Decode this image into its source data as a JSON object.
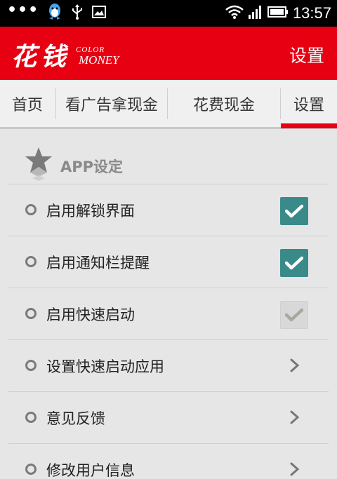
{
  "status_bar": {
    "dots": "•••",
    "time": "13:57"
  },
  "header": {
    "logo_cn": "花钱",
    "logo_en_top": "COLOR",
    "logo_en_bottom": "MONEY",
    "title": "设置"
  },
  "tabs": [
    {
      "label": "首页",
      "active": false
    },
    {
      "label": "看广告拿现金",
      "active": false
    },
    {
      "label": "花费现金",
      "active": false
    },
    {
      "label": "设置",
      "active": true
    }
  ],
  "section": {
    "title": "APP设定",
    "icon": "star-icon"
  },
  "settings": [
    {
      "label": "启用解锁界面",
      "control": "checkbox",
      "checked": true,
      "enabled": true
    },
    {
      "label": "启用通知栏提醒",
      "control": "checkbox",
      "checked": true,
      "enabled": true
    },
    {
      "label": "启用快速启动",
      "control": "checkbox",
      "checked": true,
      "enabled": false
    },
    {
      "label": "设置快速启动应用",
      "control": "chevron-right-icon"
    },
    {
      "label": "意见反馈",
      "control": "chevron-right-icon"
    },
    {
      "label": "修改用户信息",
      "control": "chevron-right-icon"
    }
  ],
  "colors": {
    "brand_red": "#e60012",
    "checkbox_on": "#3a8a8a",
    "checkbox_off": "#d8d8d8",
    "background": "#e6e6e6"
  }
}
